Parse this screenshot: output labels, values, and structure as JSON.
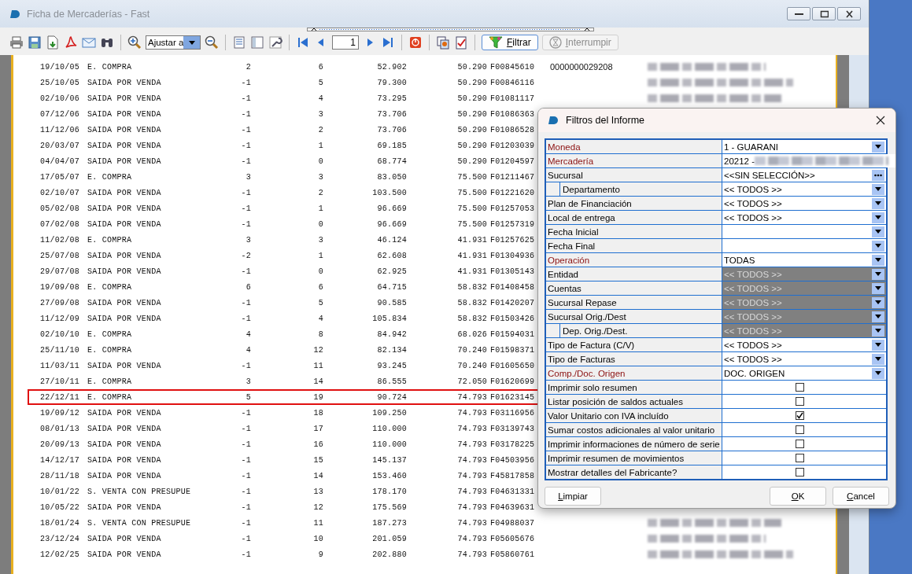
{
  "window": {
    "title": "Ficha de Mercaderías - Fast"
  },
  "toolbar": {
    "zoom": "Ajustar a",
    "page": "1",
    "buttons": [
      {
        "label": "Filtrar",
        "kind": "filter",
        "disabled": false
      },
      {
        "label": "Interrumpir",
        "kind": "stop",
        "disabled": true
      }
    ]
  },
  "report": {
    "rows": [
      {
        "date": "19/10/05",
        "type": "E. COMPRA",
        "qty": "2",
        "balance": "6",
        "price": "52.902",
        "cost": "50.290",
        "document": "F00845610",
        "reference": "0000000029208",
        "selected": false
      },
      {
        "date": "25/10/05",
        "type": "SAIDA POR VENDA",
        "qty": "-1",
        "balance": "5",
        "price": "79.300",
        "cost": "50.290",
        "document": "F00846116",
        "selected": false
      },
      {
        "date": "02/10/06",
        "type": "SAIDA POR VENDA",
        "qty": "-1",
        "balance": "4",
        "price": "73.295",
        "cost": "50.290",
        "document": "F01081117",
        "selected": false
      },
      {
        "date": "07/12/06",
        "type": "SAIDA POR VENDA",
        "qty": "-1",
        "balance": "3",
        "price": "73.706",
        "cost": "50.290",
        "document": "F01086363",
        "selected": false
      },
      {
        "date": "11/12/06",
        "type": "SAIDA POR VENDA",
        "qty": "-1",
        "balance": "2",
        "price": "73.706",
        "cost": "50.290",
        "document": "F01086528",
        "selected": false
      },
      {
        "date": "20/03/07",
        "type": "SAIDA POR VENDA",
        "qty": "-1",
        "balance": "1",
        "price": "69.185",
        "cost": "50.290",
        "document": "F01203039",
        "selected": false
      },
      {
        "date": "04/04/07",
        "type": "SAIDA POR VENDA",
        "qty": "-1",
        "balance": "0",
        "price": "68.774",
        "cost": "50.290",
        "document": "F01204597",
        "selected": false
      },
      {
        "date": "17/05/07",
        "type": "E. COMPRA",
        "qty": "3",
        "balance": "3",
        "price": "83.050",
        "cost": "75.500",
        "document": "F01211467",
        "selected": false
      },
      {
        "date": "02/10/07",
        "type": "SAIDA POR VENDA",
        "qty": "-1",
        "balance": "2",
        "price": "103.500",
        "cost": "75.500",
        "document": "F01221620",
        "selected": false
      },
      {
        "date": "05/02/08",
        "type": "SAIDA POR VENDA",
        "qty": "-1",
        "balance": "1",
        "price": "96.669",
        "cost": "75.500",
        "document": "F01257053",
        "selected": false
      },
      {
        "date": "07/02/08",
        "type": "SAIDA POR VENDA",
        "qty": "-1",
        "balance": "0",
        "price": "96.669",
        "cost": "75.500",
        "document": "F01257319",
        "selected": false
      },
      {
        "date": "11/02/08",
        "type": "E. COMPRA",
        "qty": "3",
        "balance": "3",
        "price": "46.124",
        "cost": "41.931",
        "document": "F01257625",
        "selected": false
      },
      {
        "date": "25/07/08",
        "type": "SAIDA POR VENDA",
        "qty": "-2",
        "balance": "1",
        "price": "62.608",
        "cost": "41.931",
        "document": "F01304936",
        "selected": false
      },
      {
        "date": "29/07/08",
        "type": "SAIDA POR VENDA",
        "qty": "-1",
        "balance": "0",
        "price": "62.925",
        "cost": "41.931",
        "document": "F01305143",
        "selected": false
      },
      {
        "date": "19/09/08",
        "type": "E. COMPRA",
        "qty": "6",
        "balance": "6",
        "price": "64.715",
        "cost": "58.832",
        "document": "F01408458",
        "selected": false
      },
      {
        "date": "27/09/08",
        "type": "SAIDA POR VENDA",
        "qty": "-1",
        "balance": "5",
        "price": "90.585",
        "cost": "58.832",
        "document": "F01420207",
        "selected": false
      },
      {
        "date": "11/12/09",
        "type": "SAIDA POR VENDA",
        "qty": "-1",
        "balance": "4",
        "price": "105.834",
        "cost": "58.832",
        "document": "F01503426",
        "selected": false
      },
      {
        "date": "02/10/10",
        "type": "E. COMPRA",
        "qty": "4",
        "balance": "8",
        "price": "84.942",
        "cost": "68.026",
        "document": "F01594031",
        "selected": false
      },
      {
        "date": "25/11/10",
        "type": "E. COMPRA",
        "qty": "4",
        "balance": "12",
        "price": "82.134",
        "cost": "70.240",
        "document": "F01598371",
        "selected": false
      },
      {
        "date": "11/03/11",
        "type": "SAIDA POR VENDA",
        "qty": "-1",
        "balance": "11",
        "price": "93.245",
        "cost": "70.240",
        "document": "F01605650",
        "selected": false
      },
      {
        "date": "27/10/11",
        "type": "E. COMPRA",
        "qty": "3",
        "balance": "14",
        "price": "86.555",
        "cost": "72.050",
        "document": "F01620699",
        "selected": false
      },
      {
        "date": "22/12/11",
        "type": "E. COMPRA",
        "qty": "5",
        "balance": "19",
        "price": "90.724",
        "cost": "74.793",
        "document": "F01623145",
        "selected": true
      },
      {
        "date": "19/09/12",
        "type": "SAIDA POR VENDA",
        "qty": "-1",
        "balance": "18",
        "price": "109.250",
        "cost": "74.793",
        "document": "F03116956",
        "selected": false
      },
      {
        "date": "08/01/13",
        "type": "SAIDA POR VENDA",
        "qty": "-1",
        "balance": "17",
        "price": "110.000",
        "cost": "74.793",
        "document": "F03139743",
        "selected": false
      },
      {
        "date": "20/09/13",
        "type": "SAIDA POR VENDA",
        "qty": "-1",
        "balance": "16",
        "price": "110.000",
        "cost": "74.793",
        "document": "F03178225",
        "selected": false
      },
      {
        "date": "14/12/17",
        "type": "SAIDA POR VENDA",
        "qty": "-1",
        "balance": "15",
        "price": "145.137",
        "cost": "74.793",
        "document": "F04503956",
        "selected": false
      },
      {
        "date": "28/11/18",
        "type": "SAIDA POR VENDA",
        "qty": "-1",
        "balance": "14",
        "price": "153.460",
        "cost": "74.793",
        "document": "F45817858",
        "selected": false
      },
      {
        "date": "10/01/22",
        "type": "S. VENTA CON PRESUPUE",
        "qty": "-1",
        "balance": "13",
        "price": "178.170",
        "cost": "74.793",
        "document": "F04631331",
        "selected": false
      },
      {
        "date": "10/05/22",
        "type": "SAIDA POR VENDA",
        "qty": "-1",
        "balance": "12",
        "price": "175.569",
        "cost": "74.793",
        "document": "F04639631",
        "selected": false
      },
      {
        "date": "18/01/24",
        "type": "S. VENTA CON PRESUPUE",
        "qty": "-1",
        "balance": "11",
        "price": "187.273",
        "cost": "74.793",
        "document": "F04988037",
        "selected": false
      },
      {
        "date": "23/12/24",
        "type": "SAIDA POR VENDA",
        "qty": "-1",
        "balance": "10",
        "price": "201.059",
        "cost": "74.793",
        "document": "F05605676",
        "selected": false
      },
      {
        "date": "12/02/25",
        "type": "SAIDA POR VENDA",
        "qty": "-1",
        "balance": "9",
        "price": "202.880",
        "cost": "74.793",
        "document": "F05860761",
        "selected": false
      }
    ]
  },
  "dialog": {
    "title": "Filtros del Informe",
    "fields": [
      {
        "label": "Moneda",
        "kind": "select",
        "required": true,
        "disabled": false,
        "value": "1 - GUARANI"
      },
      {
        "label": "Mercadería",
        "kind": "select",
        "required": true,
        "disabled": false,
        "value": "20212 -"
      },
      {
        "label": "Sucursal",
        "kind": "lookup",
        "required": false,
        "disabled": false,
        "value": "<<SIN SELECCIÓN>>",
        "children": [
          {
            "label": "Departamento",
            "kind": "select",
            "required": false,
            "disabled": false,
            "value": "<< TODOS >>"
          }
        ]
      },
      {
        "label": "Plan de Financiación",
        "kind": "select",
        "required": false,
        "disabled": false,
        "value": "<< TODOS >>"
      },
      {
        "label": "Local de entrega",
        "kind": "select",
        "required": false,
        "disabled": false,
        "value": "<< TODOS >>"
      },
      {
        "label": "Fecha Inicial",
        "kind": "select",
        "required": false,
        "disabled": false
      },
      {
        "label": "Fecha Final",
        "kind": "select",
        "required": false,
        "disabled": false
      },
      {
        "label": "Operación",
        "kind": "select",
        "required": true,
        "disabled": false,
        "value": "TODAS"
      },
      {
        "label": "Entidad",
        "kind": "select",
        "required": false,
        "disabled": true,
        "value": "<< TODOS >>"
      },
      {
        "label": "Cuentas",
        "kind": "select",
        "required": false,
        "disabled": true,
        "value": "<< TODOS >>"
      },
      {
        "label": "Sucursal Repase",
        "kind": "select",
        "required": false,
        "disabled": true,
        "value": "<< TODOS >>"
      },
      {
        "label": "Sucursal Orig./Dest",
        "kind": "select",
        "required": false,
        "disabled": true,
        "value": "<< TODOS >>",
        "children": [
          {
            "label": "Dep. Orig./Dest.",
            "kind": "select",
            "required": false,
            "disabled": true,
            "value": "<< TODOS >>"
          }
        ]
      },
      {
        "label": "Tipo de Factura (C/V)",
        "kind": "select",
        "required": false,
        "disabled": false,
        "value": "<< TODOS >>"
      },
      {
        "label": "Tipo de Facturas",
        "kind": "select",
        "required": false,
        "disabled": false,
        "value": "<< TODOS >>"
      },
      {
        "label": "Comp./Doc. Origen",
        "kind": "select",
        "required": true,
        "disabled": false,
        "value": "DOC. ORIGEN"
      },
      {
        "label": "Imprimir solo resumen",
        "kind": "check",
        "checked": false
      },
      {
        "label": "Listar posición de saldos actuales",
        "kind": "check",
        "checked": false
      },
      {
        "label": "Valor Unitario con IVA incluído",
        "kind": "check",
        "checked": true
      },
      {
        "label": "Sumar costos adicionales al valor unitario",
        "kind": "check",
        "checked": false
      },
      {
        "label": "Imprimir informaciones de número de serie",
        "kind": "check",
        "checked": false
      },
      {
        "label": "Imprimir resumen de movimientos",
        "kind": "check",
        "checked": false
      },
      {
        "label": "Mostrar detalles del Fabricante?",
        "kind": "check",
        "checked": false
      }
    ],
    "buttons": [
      {
        "label": "Limpiar",
        "kind": "left"
      },
      {
        "label": "OK",
        "kind": "right"
      },
      {
        "label": "Cancel",
        "kind": "right"
      }
    ]
  }
}
